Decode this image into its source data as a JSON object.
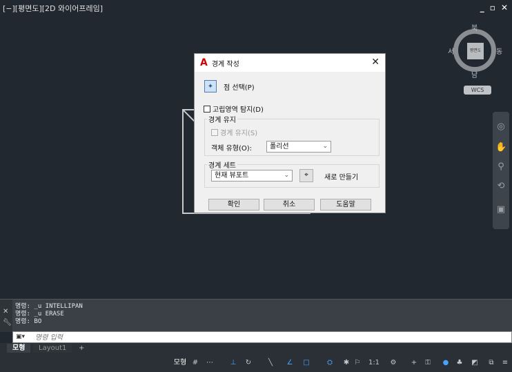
{
  "viewport": {
    "label": "[−][평면도][2D 와이어프레임]"
  },
  "window_controls": {
    "minimize": "_",
    "restore": "▫",
    "close": "✕"
  },
  "viewcube": {
    "north": "북",
    "south": "남",
    "east": "동",
    "west": "서",
    "face": "평면도",
    "wcs": "WCS"
  },
  "dialog": {
    "title": "경계 작성",
    "close": "✕",
    "pick_points": "점 선택(P)",
    "island_detection": "고립영역 탐지(D)",
    "retain_group": {
      "label": "경계 유지",
      "retain_checkbox": "경계 유지(S)",
      "object_type_label": "객체 유형(O):",
      "object_type_value": "폴리선"
    },
    "boundary_set": {
      "label": "경계 세트",
      "value": "현재 뷰포트",
      "new_label": "새로 만들기"
    },
    "buttons": {
      "ok": "확인",
      "cancel": "취소",
      "help": "도움말"
    }
  },
  "command": {
    "history": [
      "명령: _u INTELLIPAN",
      "명령: _u ERASE",
      "명령: BO"
    ],
    "input_placeholder": "명령 입력"
  },
  "tabs": [
    "모형",
    "Layout1",
    "+"
  ],
  "statusbar": {
    "model": "모형",
    "scale": "1:1"
  }
}
